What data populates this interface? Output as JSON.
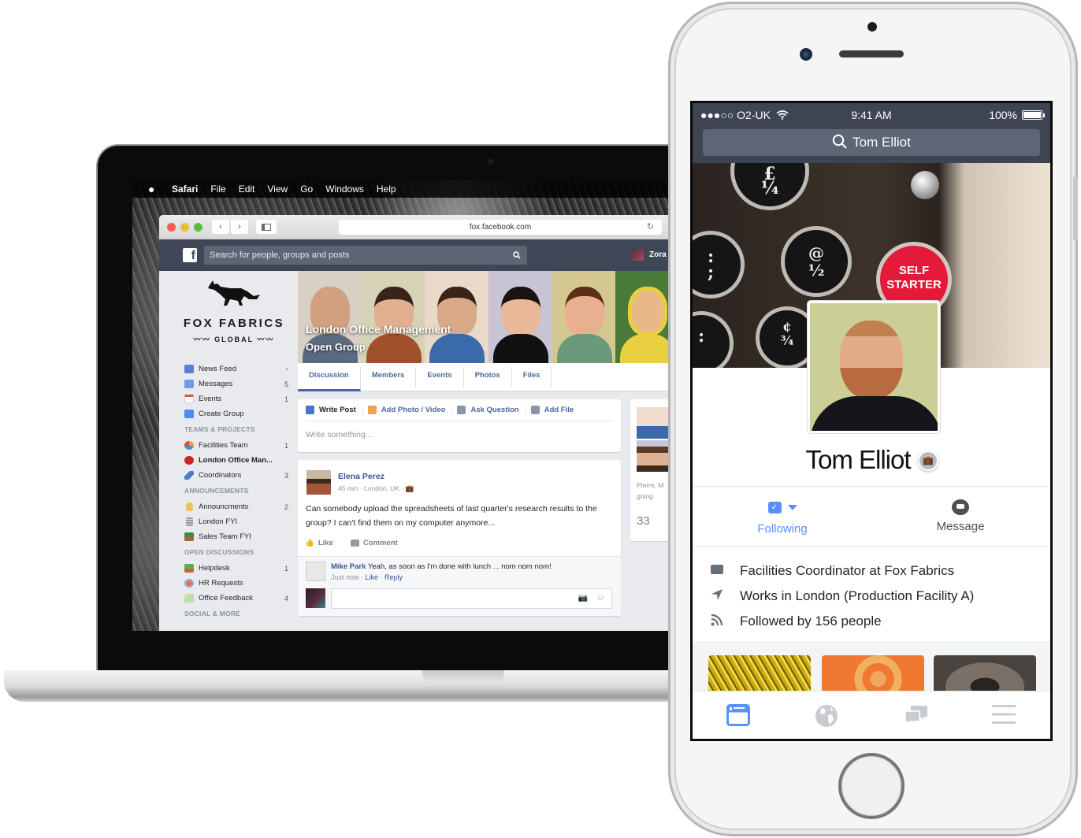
{
  "laptop": {
    "menubar": {
      "apple_icon": "apple-icon",
      "app_name": "Safari",
      "items": [
        "File",
        "Edit",
        "View",
        "Go",
        "Windows",
        "Help"
      ]
    },
    "browser": {
      "url": "fox.facebook.com",
      "back_icon": "‹",
      "forward_icon": "›",
      "reload_icon": "↻"
    },
    "fb_header": {
      "logo": "f",
      "search_placeholder": "Search for people, groups and posts",
      "search_icon": "⚲",
      "user_name": "Zora"
    },
    "brand": {
      "name": "FOX FABRICS",
      "sub": "〰〰 GLOBAL 〰〰"
    },
    "sidebar": {
      "main": [
        {
          "label": "News Feed",
          "count": "▾",
          "icon": "news-feed-icon",
          "color": "#5a7fd6"
        },
        {
          "label": "Messages",
          "count": "5",
          "icon": "messages-icon",
          "color": "#6d9de8"
        },
        {
          "label": "Events",
          "count": "1",
          "icon": "events-icon",
          "color": "#d9534f"
        },
        {
          "label": "Create Group",
          "count": "",
          "icon": "create-group-icon",
          "color": "#4a8cf0"
        }
      ],
      "sections": [
        {
          "title": "TEAMS & PROJECTS",
          "items": [
            {
              "label": "Facilities Team",
              "count": "1",
              "icon": "facilities-team-icon",
              "color": "#e8a040"
            },
            {
              "label": "London Office Man...",
              "count": "",
              "icon": "london-office-icon",
              "color": "#c62828",
              "active": true
            },
            {
              "label": "Coordinators",
              "count": "3",
              "icon": "coordinators-icon",
              "color": "#4a7ec8"
            }
          ]
        },
        {
          "title": "ANNOUNCEMENTS",
          "items": [
            {
              "label": "Announcments",
              "count": "2",
              "icon": "lightbulb-icon",
              "color": "#f0c050"
            },
            {
              "label": "London FYI",
              "count": "",
              "icon": "london-fyi-icon",
              "color": "#9a9a9a"
            },
            {
              "label": "Sales Team FYI",
              "count": "",
              "icon": "sales-team-icon",
              "color": "#3d8a4a"
            }
          ]
        },
        {
          "title": "OPEN DISCUSSIONS",
          "items": [
            {
              "label": "Helpdesk",
              "count": "1",
              "icon": "plant-icon",
              "color": "#5cae4a"
            },
            {
              "label": "HR Requests",
              "count": "",
              "icon": "hr-requests-icon",
              "color": "#e57040"
            },
            {
              "label": "Office Feedback",
              "count": "4",
              "icon": "rainbow-icon",
              "color": "#c0d9a0"
            }
          ]
        },
        {
          "title": "SOCIAL & MORE",
          "items": []
        }
      ]
    },
    "group": {
      "name": "London Office Management",
      "type": "Open Group",
      "tabs": [
        "Discussion",
        "Members",
        "Events",
        "Photos",
        "Files"
      ],
      "active_tab": "Discussion"
    },
    "composer": {
      "actions": [
        {
          "label": "Write Post",
          "icon": "pencil-icon",
          "color": "#4a76c8",
          "active": true
        },
        {
          "label": "Add Photo / Video",
          "icon": "photo-icon",
          "color": "#f0a050"
        },
        {
          "label": "Ask Question",
          "icon": "question-icon",
          "color": "#8a94a4"
        },
        {
          "label": "Add File",
          "icon": "add-file-icon",
          "color": "#8a94a4"
        }
      ],
      "placeholder": "Write something..."
    },
    "post": {
      "author": "Elena Perez",
      "meta": "45 min · London, UK · 💼",
      "body": "Can somebody upload the spreadsheets of last quarter's research results to the group? I can't find them on my computer anymore...",
      "like_label": "Like",
      "comment_label": "Comment",
      "comment": {
        "author": "Mike Park",
        "text": " Yeah, as soon as I'm done with lunch ... nom nom nom!",
        "time": "Just now",
        "like": "Like",
        "reply": "Reply"
      }
    },
    "side_panel": {
      "text_line1": "Pierre, M",
      "text_line2": "going",
      "count": "33"
    }
  },
  "phone": {
    "status": {
      "carrier": "●●●○○ O2-UK",
      "wifi_icon": "wifi-icon",
      "time": "9:41 AM",
      "battery_text": "100%",
      "battery_level": 1.0
    },
    "search_text": "Tom Elliot",
    "cover": {
      "badge_line1": "SELF",
      "badge_line2": "STARTER"
    },
    "profile": {
      "name": "Tom Elliot",
      "badge_icon": "work-badge-icon"
    },
    "actions": {
      "following_label": "Following",
      "message_label": "Message"
    },
    "about": [
      {
        "icon": "briefcase-icon",
        "glyph": "💼",
        "text": "Facilities Coordinator at Fox Fabrics"
      },
      {
        "icon": "location-arrow-icon",
        "glyph": "➤",
        "text": "Works in London (Production Facility A)"
      },
      {
        "icon": "rss-icon",
        "glyph": "≋",
        "text": "Followed by 156 people"
      }
    ],
    "tabbar": [
      {
        "name": "news-feed",
        "active": true
      },
      {
        "name": "globe",
        "active": false
      },
      {
        "name": "messages",
        "active": false
      },
      {
        "name": "menu",
        "active": false
      }
    ],
    "colors": {
      "accent": "#5890ff",
      "header": "#3e4452"
    }
  }
}
